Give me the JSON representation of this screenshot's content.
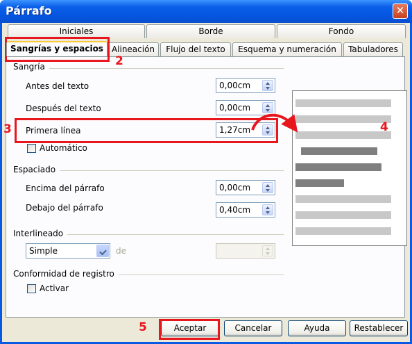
{
  "window": {
    "title": "Párrafo"
  },
  "tabs_back": [
    {
      "label": "Iniciales"
    },
    {
      "label": "Borde"
    },
    {
      "label": "Fondo"
    }
  ],
  "tabs_front": [
    {
      "label": "Sangrías y espacios",
      "active": true
    },
    {
      "label": "Alineación"
    },
    {
      "label": "Flujo del texto"
    },
    {
      "label": "Esquema y numeración"
    },
    {
      "label": "Tabuladores"
    }
  ],
  "sangria": {
    "group_label": "Sangría",
    "antes": {
      "label": "Antes del texto",
      "value": "0,00cm"
    },
    "despues": {
      "label": "Después del texto",
      "value": "0,00cm"
    },
    "primera": {
      "label": "Primera línea",
      "value": "1,27cm"
    },
    "automatico": {
      "label": "Automático",
      "checked": false
    }
  },
  "espaciado": {
    "group_label": "Espaciado",
    "encima": {
      "label": "Encima del párrafo",
      "value": "0,00cm"
    },
    "debajo": {
      "label": "Debajo del párrafo",
      "value": "0,40cm"
    }
  },
  "interlineado": {
    "group_label": "Interlineado",
    "selected": "Simple",
    "de_label": "de",
    "de_value": ""
  },
  "registro": {
    "group_label": "Conformidad de registro",
    "activar": {
      "label": "Activar",
      "checked": false
    }
  },
  "buttons": {
    "aceptar": "Aceptar",
    "cancelar": "Cancelar",
    "ayuda": "Ayuda",
    "restablecer": "Restablecer"
  },
  "annotations": [
    "2",
    "3",
    "4",
    "5"
  ],
  "colors": {
    "annotation": "#E8171E",
    "title_bar": "#0A59E3",
    "dialog_bg": "#ECE9D8"
  }
}
